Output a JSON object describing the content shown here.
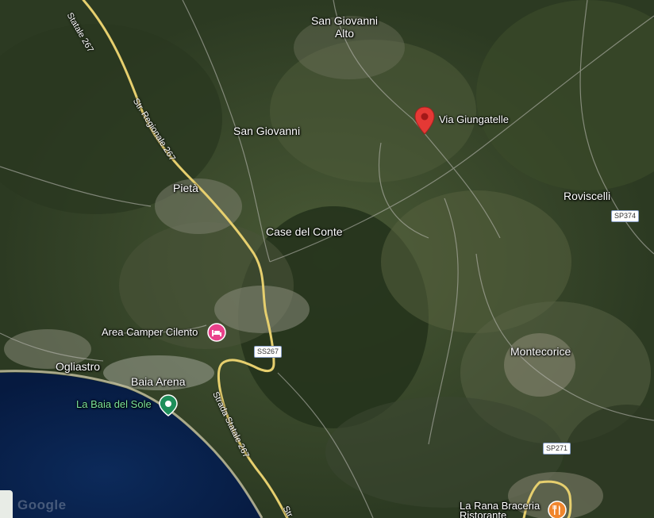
{
  "map": {
    "places": [
      {
        "key": "san_giovanni_alto",
        "name": "San Giovanni\nAlto"
      },
      {
        "key": "san_giovanni",
        "name": "San Giovanni"
      },
      {
        "key": "pieta",
        "name": "Pietà"
      },
      {
        "key": "case_del_conte",
        "name": "Case del Conte"
      },
      {
        "key": "roviscelli",
        "name": "Roviscelli"
      },
      {
        "key": "montecorice",
        "name": "Montecorice"
      },
      {
        "key": "ogliastro",
        "name": "Ogliastro"
      },
      {
        "key": "baia_arena",
        "name": "Baia Arena"
      }
    ],
    "pin": {
      "label": "Via Giungatelle",
      "color": "#e53935"
    },
    "pois": {
      "camper": {
        "label": "Area Camper Cilento",
        "icon": "bed-icon",
        "color": "#e9418a"
      },
      "beach": {
        "label": "La Baia del Sole",
        "icon": "park-pin-icon",
        "color": "#1e8e5a"
      },
      "restaurant": {
        "label": "La Rana Braceria\nRistorante",
        "icon": "fork-knife-icon",
        "color": "#f0862d"
      }
    },
    "roads": {
      "ss267_top": "Statale 267",
      "regionale": "Str. Regionale 267",
      "strada_statale": "Strada Statale 267",
      "st_bottom": "Str"
    },
    "shields": {
      "sp374": "SP374",
      "ss267": "SS267",
      "sp271": "SP271"
    },
    "watermark": "Google"
  }
}
